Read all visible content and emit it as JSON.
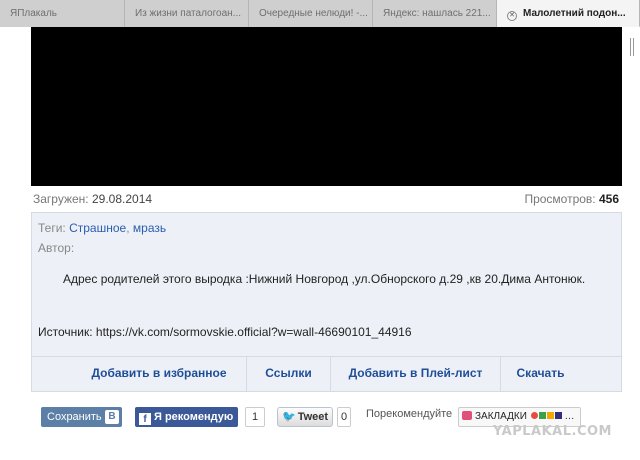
{
  "tabs": [
    {
      "label": "ЯПлакаль"
    },
    {
      "label": "Из жизни паталогоан..."
    },
    {
      "label": "Очередные нелюди! -..."
    },
    {
      "label": "Яндекс: нашлась 221..."
    },
    {
      "label": "Малолетний подон..."
    }
  ],
  "meta": {
    "uploaded_label": "Загружен:",
    "uploaded_date": "29.08.2014",
    "views_label": "Просмотров:",
    "views_count": "456"
  },
  "info": {
    "tags_label": "Теги:",
    "tag1": "Страшное",
    "tag_sep": ",",
    "tag2": "мразь",
    "author_label": "Автор:",
    "description": "Адрес родителей этого выродка :Нижний Новгород ,ул.Обнорского д.29 ,кв 20.Дима Антонюк.",
    "source": "Источник: https://vk.com/sormovskie.official?w=wall-46690101_44916"
  },
  "actions": {
    "favorite": "Добавить в избранное",
    "links": "Ссылки",
    "playlist": "Добавить в Плей-лист",
    "download": "Скачать"
  },
  "share": {
    "save_label": "Сохранить",
    "vk_letter": "B",
    "fb_letter": "f",
    "fb_label": "Я рекомендую",
    "fb_count": "1",
    "tweet_label": "Tweet",
    "tweet_count": "0",
    "recommend_label": "Порекомендуйте",
    "bookmarks_label": "ЗАКЛАДКИ"
  },
  "watermark": "YAPLAKAL.COM",
  "colors": {
    "accent": "#1f4e99",
    "info_bg": "#edf1f7",
    "fb_blue": "#3b5998",
    "vk_blue": "#5b7fa6"
  }
}
